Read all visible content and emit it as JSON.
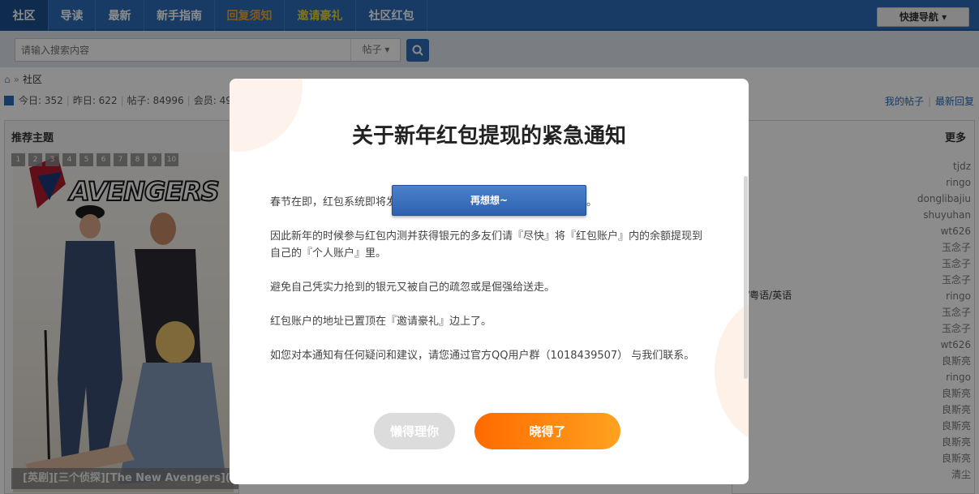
{
  "nav": {
    "items": [
      {
        "label": "社区",
        "style": "active"
      },
      {
        "label": "导读",
        "style": "normal"
      },
      {
        "label": "最新",
        "style": "normal"
      },
      {
        "label": "新手指南",
        "style": "normal"
      },
      {
        "label": "回复须知",
        "style": "orange"
      },
      {
        "label": "邀请豪礼",
        "style": "yellow"
      },
      {
        "label": "社区红包",
        "style": "normal"
      }
    ],
    "quick_nav": "快捷导航"
  },
  "search": {
    "placeholder": "请输入搜索内容",
    "type": "帖子"
  },
  "breadcrumb": {
    "home_sep": "»",
    "current": "社区"
  },
  "stats": {
    "today": "今日: 352",
    "yesterday": "昨日: 622",
    "posts": "帖子: 84996",
    "members": "会员: 49"
  },
  "right_links": {
    "my_posts": "我的帖子",
    "latest_replies": "最新回复"
  },
  "left_panel": {
    "title": "推荐主题",
    "page_nums": [
      "1",
      "2",
      "3",
      "4",
      "5",
      "6",
      "7",
      "8",
      "9",
      "10"
    ],
    "poster_logo": "AVENGERS",
    "caption": "[英剧][三个侦探][The New Avengers]("
  },
  "right_panel": {
    "more": "更多",
    "lang_tag": "/粤语/英语",
    "authors": [
      "tjdz",
      "ringo",
      "donglibajiu",
      "shuyuhan",
      "wt626",
      "玉念子",
      "玉念子",
      "玉念子",
      "ringo",
      "玉念子",
      "玉念子",
      "wt626",
      "良斯亮",
      "ringo",
      "良斯亮",
      "良斯亮",
      "良斯亮",
      "良斯亮",
      "良斯亮",
      "清尘"
    ]
  },
  "modal": {
    "title": "关于新年红包提现的紧急通知",
    "reconsider": "再想想~",
    "paragraphs": [
      "春节在即，红包系统即将发　　　　　　　　　　　　　　　统数据。",
      "因此新年的时候参与红包内测并获得银元的多友们请『尽快』将『红包账户』内的余额提现到自己的『个人账户』里。",
      "避免自己凭实力抢到的银元又被自己的疏忽或是倔强给送走。",
      "红包账户的地址已置顶在『邀请豪礼』边上了。",
      "如您对本通知有任何疑问和建议，请您通过官方QQ用户群（1018439507） 与我们联系。"
    ],
    "ignore_label": "懒得理你",
    "ok_label": "晓得了"
  },
  "colors": {
    "nav_bg": "#2a6cb8",
    "ok_start": "#ff6a00",
    "ok_end": "#ffa21f",
    "ignore_bg": "#dcdcdc"
  }
}
